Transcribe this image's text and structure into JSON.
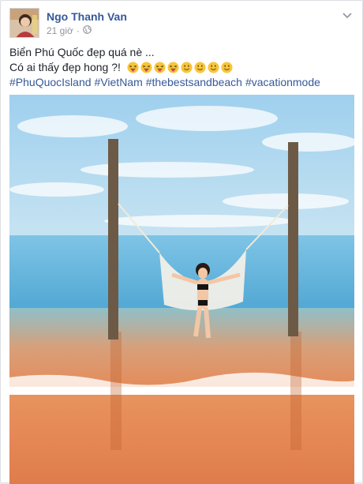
{
  "post": {
    "author_name": "Ngo Thanh Van",
    "timestamp": "21 giờ",
    "privacy_separator": "·",
    "text_line1": "Biển Phú Quốc đẹp quá nè ...",
    "text_line2": "Có ai thấy đẹp hong ?!",
    "emojis": [
      "squinting-tongue-emoji",
      "squinting-tongue-emoji",
      "squinting-tongue-emoji",
      "squinting-tongue-emoji",
      "smiley-emoji",
      "smiley-emoji",
      "smiley-emoji",
      "smiley-emoji"
    ],
    "hashtags": [
      "#PhuQuocIsland",
      "#VietNam",
      "#thebestsandbeach",
      "#vacationmode"
    ]
  },
  "icons": {
    "privacy": "globe-icon",
    "menu": "chevron-down-icon"
  },
  "colors": {
    "link": "#365899",
    "meta": "#90949c",
    "text": "#1d2129",
    "sky_top": "#a8d4ee",
    "sea": "#6ab4d8",
    "sand": "#e38e5f"
  }
}
